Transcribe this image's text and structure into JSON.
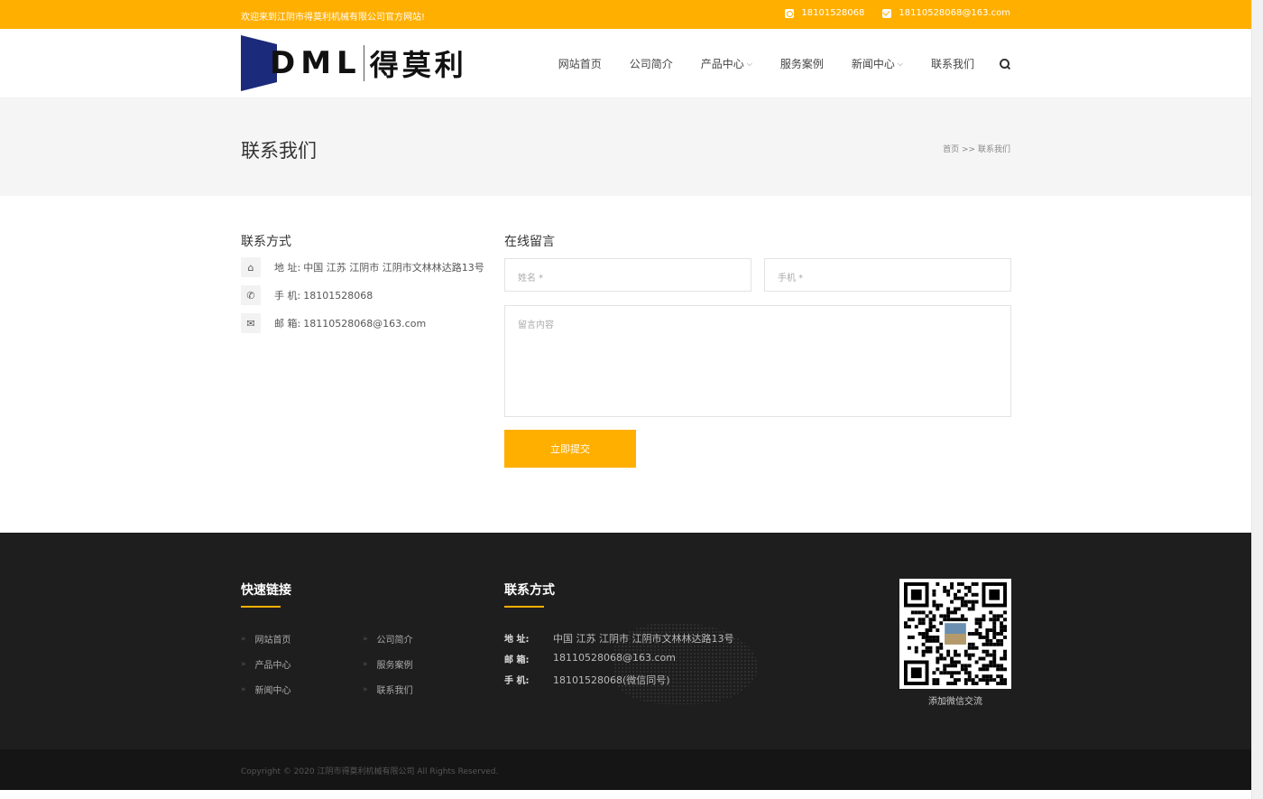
{
  "topbar": {
    "welcome": "欢迎来到江阴市得莫利机械有限公司官方网站!",
    "phone": "18101528068",
    "email": "18110528068@163.com",
    "color": "#ffaf00"
  },
  "logo": {
    "latin": "DML",
    "cn": "得莫利"
  },
  "nav": {
    "items": [
      "网站首页",
      "公司简介",
      "产品中心",
      "服务案例",
      "新闻中心",
      "联系我们"
    ]
  },
  "page_title": {
    "title": "联系我们",
    "crumb_home": "首页",
    "crumb_sep": ">>",
    "crumb_current": "联系我们"
  },
  "contact": {
    "heading": "联系方式",
    "rows": [
      {
        "icon": "home-icon",
        "label": "地 址:",
        "value": "中国 江苏 江阴市 江阴市文林林达路13号"
      },
      {
        "icon": "phone-icon",
        "label": "手 机:",
        "value": "18101528068"
      },
      {
        "icon": "envelope-icon",
        "label": "邮 箱:",
        "value": "18110528068@163.com"
      }
    ]
  },
  "form": {
    "heading": "在线留言",
    "name_placeholder": "姓名 *",
    "phone_placeholder": "手机 *",
    "message_placeholder": "留言内容",
    "submit_label": "立即提交"
  },
  "footer": {
    "links_heading": "快速链接",
    "links": [
      "网站首页",
      "公司简介",
      "产品中心",
      "服务案例",
      "新闻中心",
      "联系我们"
    ],
    "contact_heading": "联系方式",
    "contact_rows": [
      {
        "k": "地 址:",
        "v": "中国 江苏 江阴市 江阴市文林林达路13号"
      },
      {
        "k": "邮 箱:",
        "v": "18110528068@163.com"
      },
      {
        "k": "手 机:",
        "v": "18101528068(微信同号)"
      }
    ],
    "qr_caption": "添加微信交流",
    "copyright": "Copyright © 2020 江阴市得莫利机械有限公司 All Rights Reserved."
  }
}
